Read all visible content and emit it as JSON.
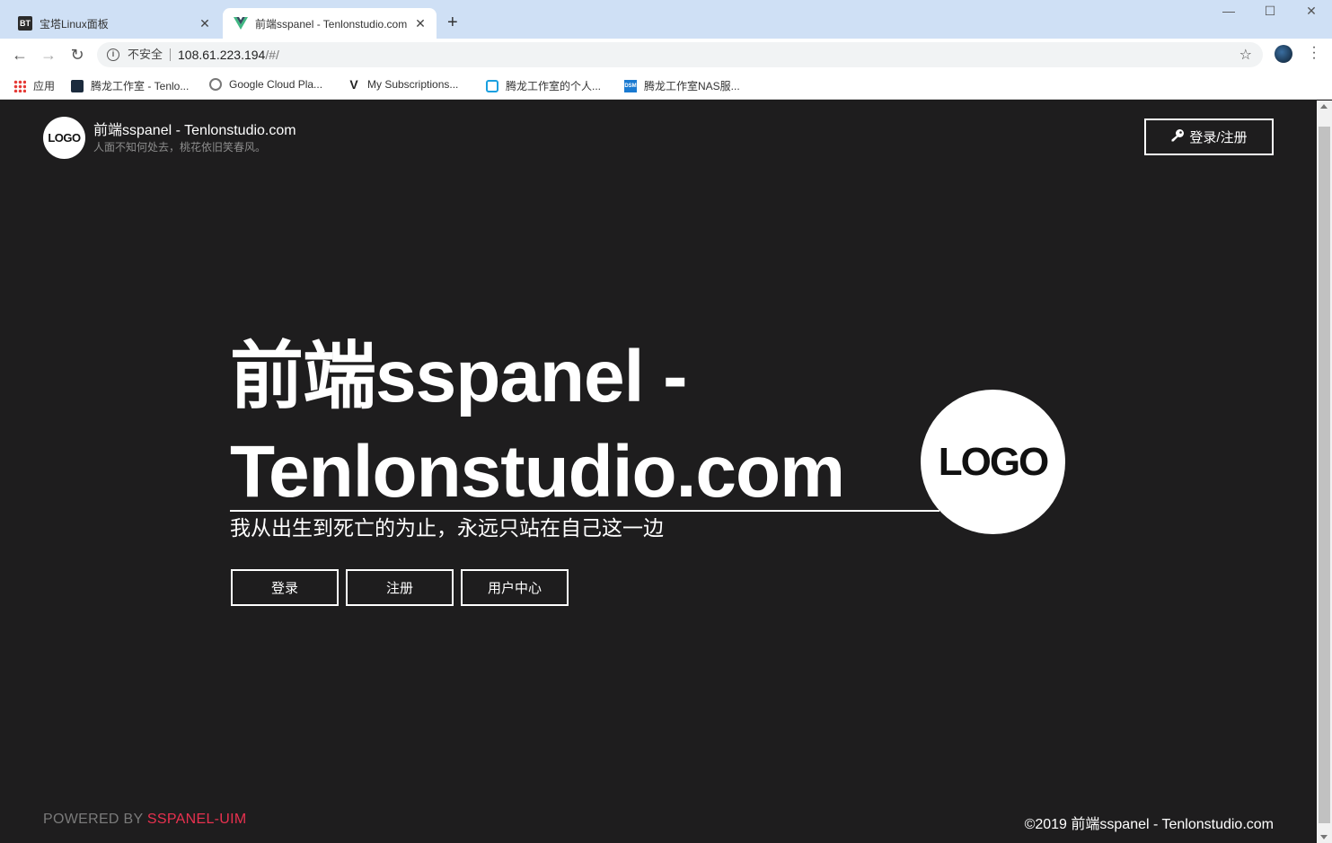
{
  "browser": {
    "tabs": [
      {
        "title": "宝塔Linux面板",
        "favicon": "BT",
        "active": false
      },
      {
        "title": "前端sspanel - Tenlonstudio.com",
        "favicon": "vue-icon",
        "active": true
      }
    ],
    "new_tab_glyph": "+",
    "window_controls": {
      "minimize": "—",
      "maximize": "☐",
      "close": "✕"
    },
    "address": {
      "security_label": "不安全",
      "host": "108.61.223.194",
      "path": "/#/"
    },
    "bookmarks": [
      {
        "label": "应用",
        "icon": "apps-grid-icon"
      },
      {
        "label": "腾龙工作室 - Tenlo...",
        "icon": "tenlon-icon"
      },
      {
        "label": "Google Cloud Pla...",
        "icon": "chromium-icon"
      },
      {
        "label": "My Subscriptions...",
        "icon": "v-icon"
      },
      {
        "label": "腾龙工作室的个人...",
        "icon": "bilibili-icon"
      },
      {
        "label": "腾龙工作室NAS服...",
        "icon": "dsm-icon"
      }
    ]
  },
  "header": {
    "logo_text": "LOGO",
    "site_title": "前端sspanel - Tenlonstudio.com",
    "site_subtitle": "人面不知何处去，桃花依旧笑春风。",
    "login_register_label": "登录/注册"
  },
  "hero": {
    "title": "前端sspanel - Tenlonstudio.com",
    "subtitle": "我从出生到死亡的为止，永远只站在自己这一边",
    "logo_text": "LOGO",
    "buttons": {
      "login": "登录",
      "register": "注册",
      "user_center": "用户中心"
    }
  },
  "footer": {
    "powered_by_prefix": "POWERED BY ",
    "powered_by_name": "SSPANEL-UIM",
    "copyright": "©2019 前端sspanel - Tenlonstudio.com"
  },
  "colors": {
    "background": "#1e1d1e",
    "accent": "#e8314f",
    "tabbar": "#cfe0f5"
  }
}
